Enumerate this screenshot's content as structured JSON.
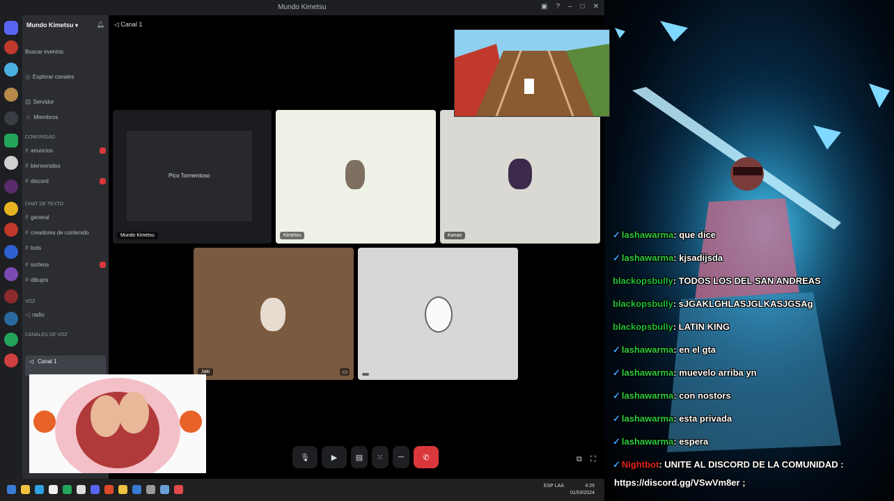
{
  "window": {
    "title": "Mundo Kimetsu"
  },
  "server": {
    "name": "Mundo Kimetsu"
  },
  "sidebar": {
    "top_items": [
      "Buscar eventos",
      "Explorar canales",
      "Servidor",
      "Miembros"
    ],
    "categories": [
      "Comunidad",
      "Chat de texto",
      "Voz",
      "Canales de voz"
    ],
    "channels": [
      "anuncios",
      "bienvenidos",
      "discord",
      "general",
      "creadores de contenido",
      "bots",
      "sorteos",
      "dibujos",
      "radio"
    ],
    "voice_channel": "Canal 1"
  },
  "call": {
    "header": "Canal 1",
    "tiles": [
      {
        "label": "Mundo Kimetsu",
        "sub": "Pico Tormentoso"
      },
      {
        "label": "Kimetsu"
      },
      {
        "label": "Kanao"
      },
      {
        "label": "Jaki"
      },
      {
        "label": ""
      }
    ]
  },
  "chat": {
    "messages": [
      {
        "user": "lashawarma",
        "text": "que dice"
      },
      {
        "user": "lashawarma",
        "text": "kjsadijsda"
      },
      {
        "user": "blackopsbully",
        "text": "TODOS LOS DEL SAN ANDREAS"
      },
      {
        "user": "blackopsbully",
        "text": "sJGAKLGHLASJGLKASJGSAg"
      },
      {
        "user": "blackopsbully",
        "text": "LATIN KING"
      },
      {
        "user": "lashawarma",
        "text": "en el gta"
      },
      {
        "user": "lashawarma",
        "text": "muevelo arriba yn"
      },
      {
        "user": "lashawarma",
        "text": "con nostors"
      },
      {
        "user": "lashawarma",
        "text": "esta privada"
      },
      {
        "user": "lashawarma",
        "text": "espera"
      }
    ],
    "pinned": {
      "user": "Nightbot",
      "text": "UNITE AL DISCORD DE LA COMUNIDAD :",
      "link": "https://discord.gg/VSwVm8er ;"
    }
  },
  "taskbar": {
    "lang": "ESP LAA",
    "time": "4:25",
    "date": "01/03/2024"
  },
  "colors": {
    "discord_red": "#da373c",
    "chat_user": "#2ecc40",
    "bot_user": "#e0241b"
  }
}
